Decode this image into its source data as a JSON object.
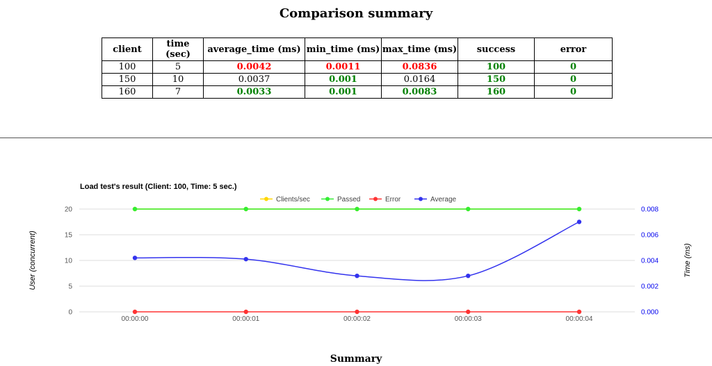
{
  "page_title": "Comparison summary",
  "table": {
    "headers": [
      "client",
      "time (sec)",
      "average_time (ms)",
      "min_time (ms)",
      "max_time (ms)",
      "success",
      "error"
    ],
    "rows": [
      [
        {
          "v": "100",
          "c": ""
        },
        {
          "v": "5",
          "c": ""
        },
        {
          "v": "0.0042",
          "c": "red"
        },
        {
          "v": "0.0011",
          "c": "red"
        },
        {
          "v": "0.0836",
          "c": "red"
        },
        {
          "v": "100",
          "c": "green"
        },
        {
          "v": "0",
          "c": "green"
        }
      ],
      [
        {
          "v": "150",
          "c": ""
        },
        {
          "v": "10",
          "c": ""
        },
        {
          "v": "0.0037",
          "c": ""
        },
        {
          "v": "0.001",
          "c": "green"
        },
        {
          "v": "0.0164",
          "c": ""
        },
        {
          "v": "150",
          "c": "green"
        },
        {
          "v": "0",
          "c": "green"
        }
      ],
      [
        {
          "v": "160",
          "c": ""
        },
        {
          "v": "7",
          "c": ""
        },
        {
          "v": "0.0033",
          "c": "green"
        },
        {
          "v": "0.001",
          "c": "green"
        },
        {
          "v": "0.0083",
          "c": "green"
        },
        {
          "v": "160",
          "c": "green"
        },
        {
          "v": "0",
          "c": "green"
        }
      ]
    ]
  },
  "footer_title": "Summary",
  "chart_data": {
    "type": "line",
    "title": "Load test's result (Client: 100, Time: 5 sec.)",
    "ylabel": "User (concurrent)",
    "y2label": "Time (ms)",
    "x": [
      "00:00:00",
      "00:00:01",
      "00:00:02",
      "00:00:03",
      "00:00:04"
    ],
    "ylim": [
      0,
      20
    ],
    "yticks": [
      "20",
      "15",
      "10",
      "5",
      "0"
    ],
    "y2lim": [
      0,
      0.008
    ],
    "y2ticks": [
      "0.008",
      "0.006",
      "0.004",
      "0.002",
      "0.000"
    ],
    "legend_position": "top",
    "grid": true,
    "series": [
      {
        "name": "Clients/sec",
        "axis": "left",
        "color": "#ffd700",
        "values": [
          20,
          20,
          20,
          20,
          20
        ]
      },
      {
        "name": "Passed",
        "axis": "left",
        "color": "#33ee33",
        "values": [
          20,
          20,
          20,
          20,
          20
        ]
      },
      {
        "name": "Error",
        "axis": "left",
        "color": "#ff3333",
        "values": [
          0,
          0,
          0,
          0,
          0
        ]
      },
      {
        "name": "Average",
        "axis": "right",
        "color": "#3333ee",
        "values": [
          0.0042,
          0.0041,
          0.0028,
          0.0028,
          0.007
        ]
      }
    ]
  }
}
